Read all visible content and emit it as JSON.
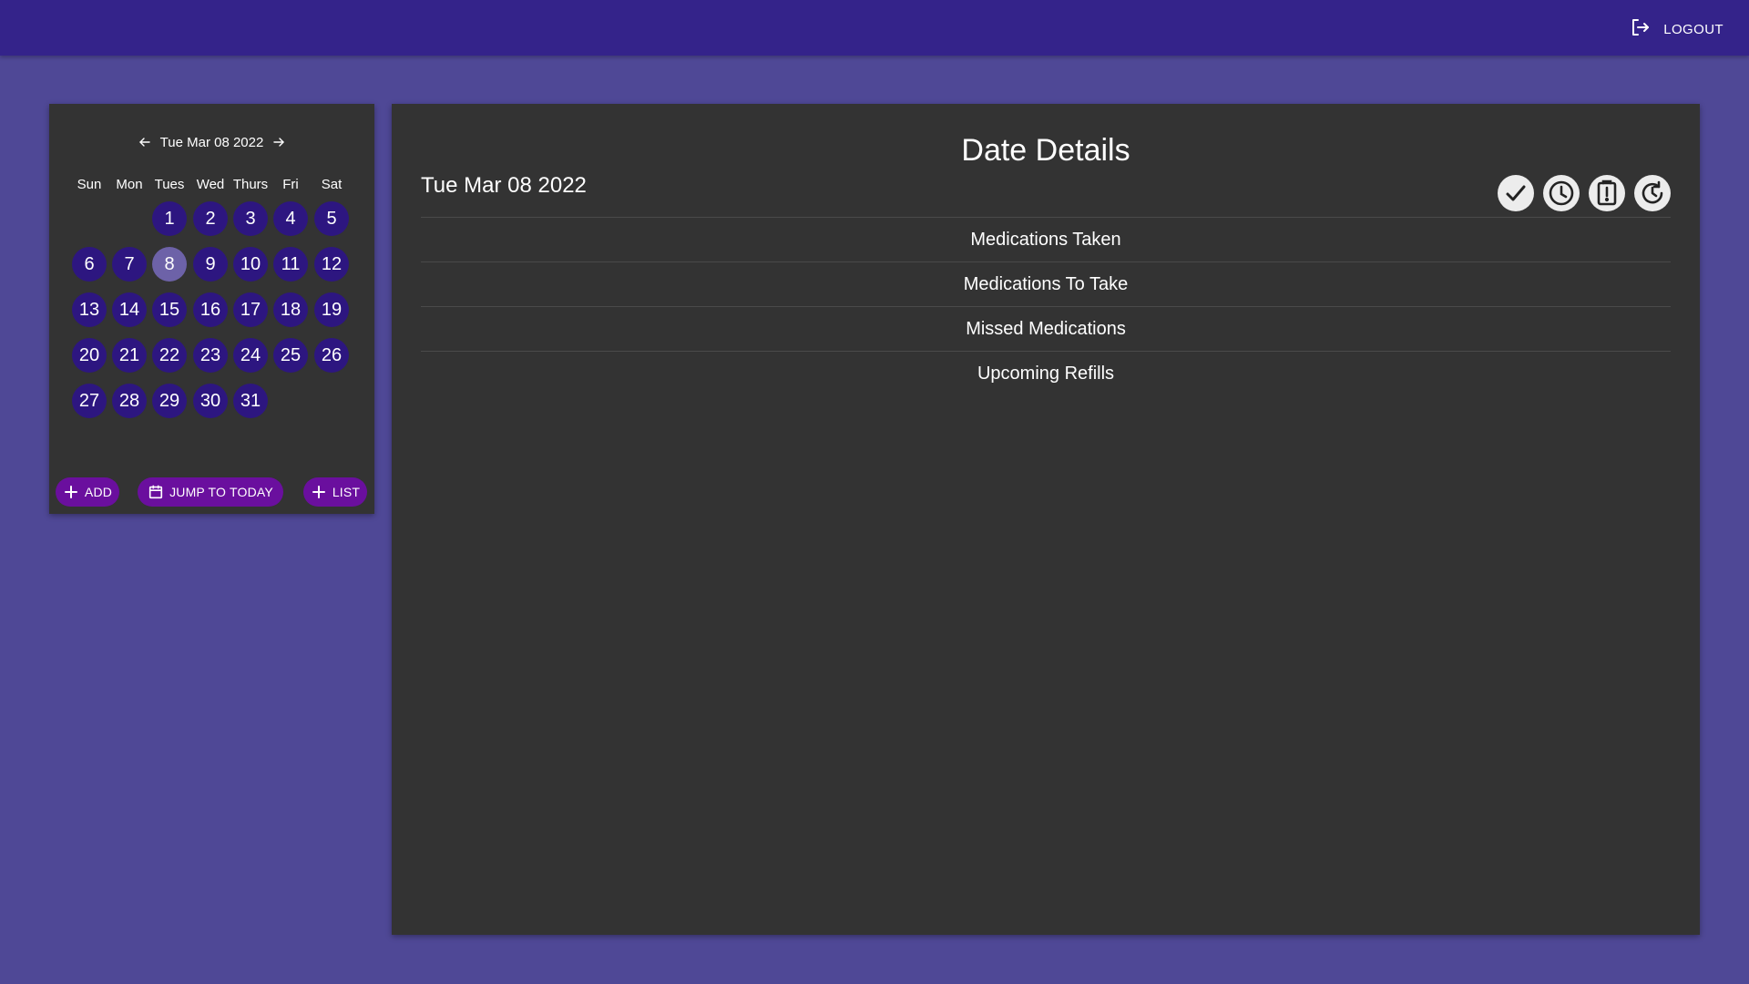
{
  "header": {
    "logout_label": "LOGOUT"
  },
  "calendar": {
    "title": "Tue Mar 08 2022",
    "weekdays": [
      "Sun",
      "Mon",
      "Tues",
      "Wed",
      "Thurs",
      "Fri",
      "Sat"
    ],
    "first_weekday_index": 2,
    "selected_day": 8,
    "days": [
      "1",
      "2",
      "3",
      "4",
      "5",
      "6",
      "7",
      "8",
      "9",
      "10",
      "11",
      "12",
      "13",
      "14",
      "15",
      "16",
      "17",
      "18",
      "19",
      "20",
      "21",
      "22",
      "23",
      "24",
      "25",
      "26",
      "27",
      "28",
      "29",
      "30",
      "31"
    ],
    "actions": {
      "add_label": "ADD",
      "jump_label": "JUMP TO TODAY",
      "list_label": "LIST"
    }
  },
  "details": {
    "title": "Date Details",
    "date": "Tue Mar 08 2022",
    "status_icons": [
      "check-icon",
      "clock-icon",
      "alert-clipboard-icon",
      "refill-icon"
    ],
    "sections": [
      "Medications Taken",
      "Medications To Take",
      "Missed Medications",
      "Upcoming Refills"
    ]
  },
  "colors": {
    "background": "#4f4896",
    "topbar": "#34238a",
    "panel": "#333333",
    "day_circle": "#2d1680",
    "day_selected": "#6d62a8",
    "action_pill": "#6a0f9e"
  }
}
